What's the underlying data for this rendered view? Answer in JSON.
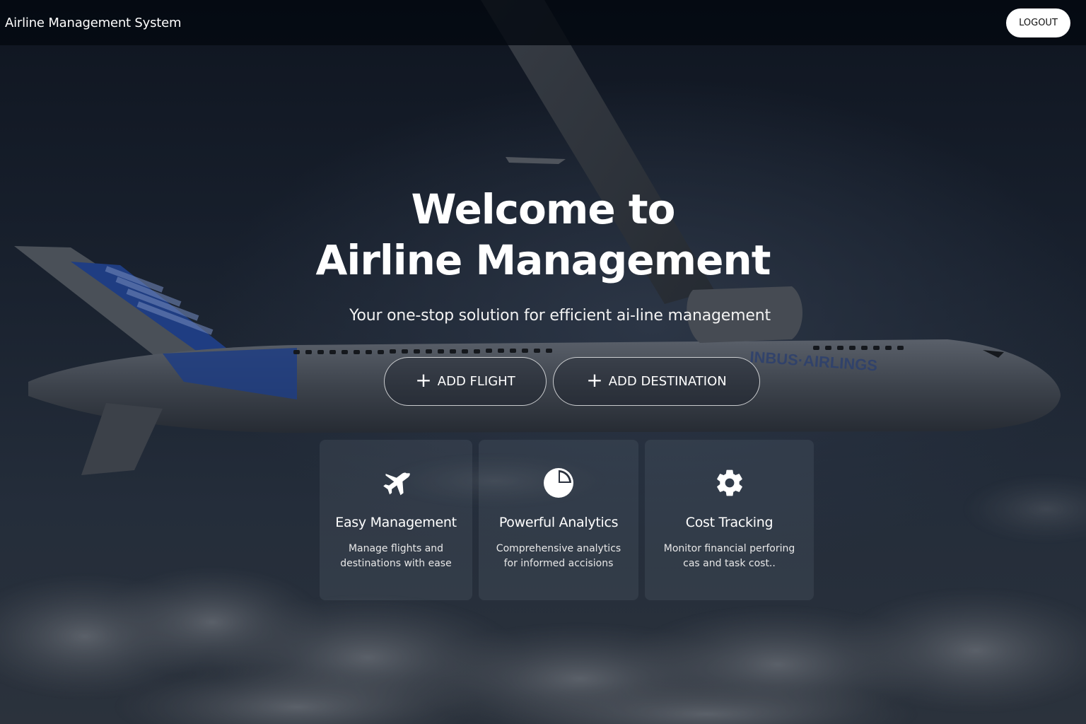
{
  "header": {
    "app_title": "Airline Management System",
    "logout_label": "LOGOUT"
  },
  "hero": {
    "title_line1": "Welcome to",
    "title_line2": "Airline Management",
    "subtitle": "Your one-stop solution for efficient ai-line management"
  },
  "actions": {
    "add_flight_label": "ADD FLIGHT",
    "add_destination_label": "ADD DESTINATION"
  },
  "features": [
    {
      "icon": "airplane-icon",
      "title": "Easy Management",
      "desc_line1": "Manage flights and",
      "desc_line2": "destinations with ease"
    },
    {
      "icon": "pie-chart-icon",
      "title": "Powerful Analytics",
      "desc_line1": "Comprehensive analytics",
      "desc_line2": "for informed accisions"
    },
    {
      "icon": "gear-icon",
      "title": "Cost Tracking",
      "desc_line1": "Monitor financial perforing",
      "desc_line2": "cas and task cost.."
    }
  ],
  "background": {
    "livery_text": "INBUS·AIRLINGS"
  },
  "colors": {
    "topbar": "#04080f",
    "accent": "#ffffff",
    "livery_blue": "#1f3d82"
  }
}
